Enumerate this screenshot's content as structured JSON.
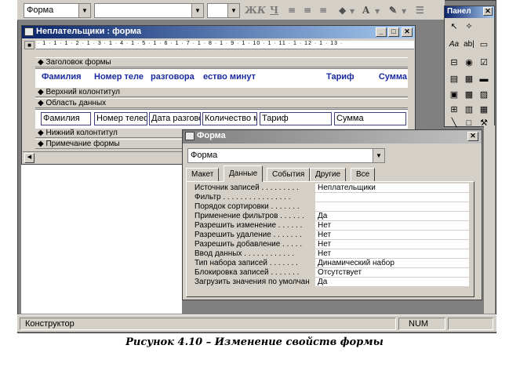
{
  "toolbar": {
    "object_combo_value": "Форма",
    "font_combo_value": "",
    "size_combo_value": "",
    "bold_icon": "Ж",
    "italic_icon": "К",
    "underline_icon": "Ч"
  },
  "form_window": {
    "title": "Неплательщики : форма",
    "ruler_text": "· 1 · 1 · 1 · 2 · 1 · 3 · 1 · 4 · 1 · 5 · 1 · 6 · 1 · 7 · 1 · 8 · 1 · 9 · 1 · 10 · 1 · 11 · 1 · 12 · 1 · 13 ·",
    "sections": {
      "form_header": "Заголовок формы",
      "page_header": "Верхний колонтитул",
      "detail": "Область данных",
      "page_footer": "Нижний колонтитул",
      "form_footer": "Примечание формы"
    },
    "header_labels": [
      "Фамилия",
      "Номер теле",
      "разговора",
      "ество минут",
      "Тариф",
      "Сумма"
    ],
    "detail_fields": [
      "Фамилия",
      "Номер телеф",
      "Дата разгово",
      "Количество м",
      "Тариф",
      "Сумма"
    ]
  },
  "toolbox": {
    "title": "Панел",
    "tools": [
      "select-pointer-icon",
      "wizard-icon",
      "label-icon",
      "textbox-icon",
      "option-group-icon",
      "toggle-button-icon",
      "option-button-icon",
      "checkbox-icon",
      "combo-box-icon",
      "list-box-icon",
      "command-button-icon",
      "image-icon",
      "unbound-frame-icon",
      "bound-frame-icon",
      "page-break-icon",
      "tab-control-icon",
      "subform-icon",
      "line-icon",
      "rectangle-icon",
      "more-tools-icon"
    ],
    "label_glyph": "Aa",
    "textbox_glyph": "ab|"
  },
  "properties": {
    "title": "Форма",
    "object_selector": "Форма",
    "tabs": [
      "Макет",
      "Данные",
      "События",
      "Другие",
      "Все"
    ],
    "active_tab": "Данные",
    "rows": [
      {
        "name": "Источник записей . . . . . . . . .",
        "value": "Неплательщики"
      },
      {
        "name": "Фильтр . . . . . . . . . . . . . . . .",
        "value": ""
      },
      {
        "name": "Порядок сортировки . . . . . . .",
        "value": ""
      },
      {
        "name": "Применение фильтров . . . . . .",
        "value": "Да"
      },
      {
        "name": "Разрешить изменение . . . . . .",
        "value": "Нет"
      },
      {
        "name": "Разрешить удаление . . . . . . .",
        "value": "Нет"
      },
      {
        "name": "Разрешить добавление . . . . .",
        "value": "Нет"
      },
      {
        "name": "Ввод данных . . . . . . . . . . . .",
        "value": "Нет"
      },
      {
        "name": "Тип набора записей . . . . . . .",
        "value": "Динамический набор"
      },
      {
        "name": "Блокировка записей . . . . . . .",
        "value": "Отсутствует"
      },
      {
        "name": "Загрузить значения по умолчан",
        "value": "Да"
      }
    ]
  },
  "statusbar": {
    "mode": "Конструктор",
    "num": "NUM"
  },
  "caption": "Рисунок 4.10 – Изменение свойств формы"
}
